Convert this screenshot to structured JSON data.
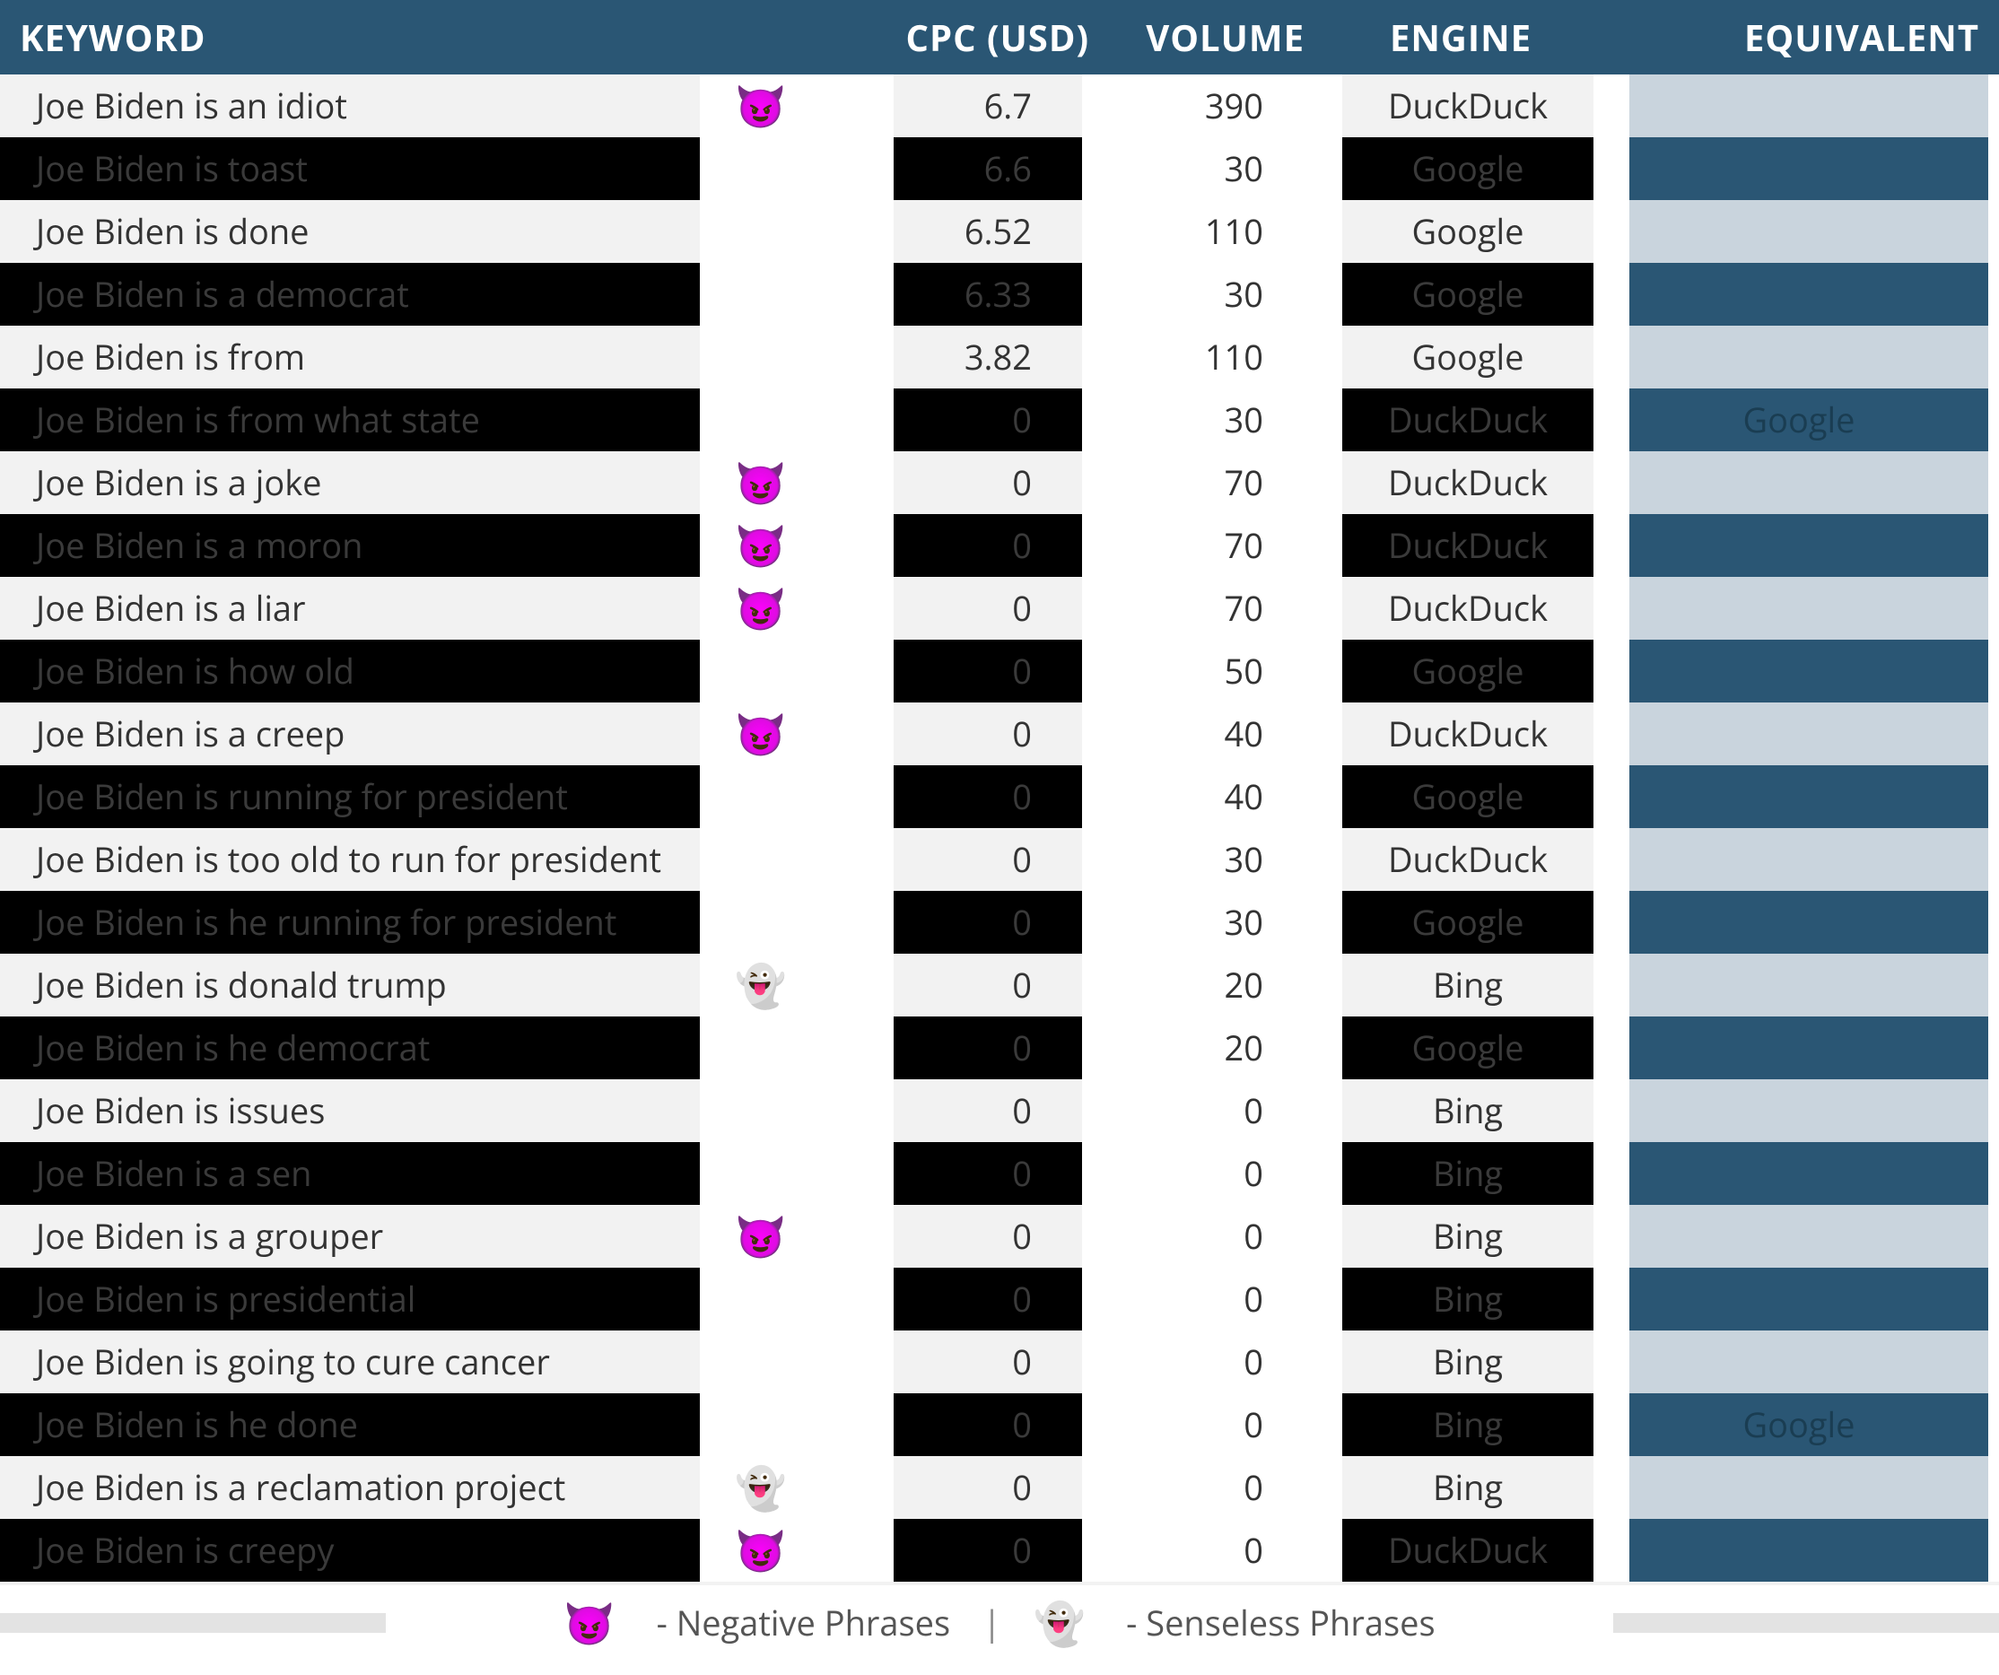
{
  "headers": {
    "keyword": "KEYWORD",
    "cpc": "CPC (USD)",
    "volume": "VOLUME",
    "engine": "ENGINE",
    "equivalent": "EQUIVALENT"
  },
  "legend": {
    "negative": "Negative Phrases",
    "senseless": "Senseless Phrases"
  },
  "rows": [
    {
      "keyword": "Joe Biden is an idiot",
      "tag": "negative",
      "cpc": "6.7",
      "volume": "390",
      "engine": "DuckDuck",
      "equivalent": "",
      "style": "light"
    },
    {
      "keyword": "Joe Biden is toast",
      "tag": "",
      "cpc": "6.6",
      "volume": "30",
      "engine": "Google",
      "equivalent": "",
      "style": "dark"
    },
    {
      "keyword": "Joe Biden is done",
      "tag": "",
      "cpc": "6.52",
      "volume": "110",
      "engine": "Google",
      "equivalent": "",
      "style": "light"
    },
    {
      "keyword": "Joe Biden is a democrat",
      "tag": "",
      "cpc": "6.33",
      "volume": "30",
      "engine": "Google",
      "equivalent": "",
      "style": "dark"
    },
    {
      "keyword": "Joe Biden is from",
      "tag": "",
      "cpc": "3.82",
      "volume": "110",
      "engine": "Google",
      "equivalent": "",
      "style": "light"
    },
    {
      "keyword": "Joe Biden is from what state",
      "tag": "",
      "cpc": "0",
      "volume": "30",
      "engine": "DuckDuck",
      "equivalent": "Google",
      "style": "dark"
    },
    {
      "keyword": "Joe Biden is a joke",
      "tag": "negative",
      "cpc": "0",
      "volume": "70",
      "engine": "DuckDuck",
      "equivalent": "",
      "style": "light"
    },
    {
      "keyword": "Joe Biden is a moron",
      "tag": "negative",
      "cpc": "0",
      "volume": "70",
      "engine": "DuckDuck",
      "equivalent": "",
      "style": "dark"
    },
    {
      "keyword": "Joe Biden is a liar",
      "tag": "negative",
      "cpc": "0",
      "volume": "70",
      "engine": "DuckDuck",
      "equivalent": "",
      "style": "light"
    },
    {
      "keyword": "Joe Biden is how old",
      "tag": "",
      "cpc": "0",
      "volume": "50",
      "engine": "Google",
      "equivalent": "",
      "style": "dark"
    },
    {
      "keyword": "Joe Biden is a creep",
      "tag": "negative",
      "cpc": "0",
      "volume": "40",
      "engine": "DuckDuck",
      "equivalent": "",
      "style": "light"
    },
    {
      "keyword": "Joe Biden is running for president",
      "tag": "",
      "cpc": "0",
      "volume": "40",
      "engine": "Google",
      "equivalent": "",
      "style": "dark"
    },
    {
      "keyword": "Joe Biden is too old to run for president",
      "tag": "",
      "cpc": "0",
      "volume": "30",
      "engine": "DuckDuck",
      "equivalent": "",
      "style": "light"
    },
    {
      "keyword": "Joe Biden is he running for president",
      "tag": "",
      "cpc": "0",
      "volume": "30",
      "engine": "Google",
      "equivalent": "",
      "style": "dark"
    },
    {
      "keyword": "Joe Biden is donald trump",
      "tag": "senseless",
      "cpc": "0",
      "volume": "20",
      "engine": "Bing",
      "equivalent": "",
      "style": "light"
    },
    {
      "keyword": "Joe Biden is he democrat",
      "tag": "",
      "cpc": "0",
      "volume": "20",
      "engine": "Google",
      "equivalent": "",
      "style": "dark"
    },
    {
      "keyword": "Joe Biden is issues",
      "tag": "",
      "cpc": "0",
      "volume": "0",
      "engine": "Bing",
      "equivalent": "",
      "style": "light"
    },
    {
      "keyword": "Joe Biden is a sen",
      "tag": "",
      "cpc": "0",
      "volume": "0",
      "engine": "Bing",
      "equivalent": "",
      "style": "dark"
    },
    {
      "keyword": "Joe Biden is a grouper",
      "tag": "negative",
      "cpc": "0",
      "volume": "0",
      "engine": "Bing",
      "equivalent": "",
      "style": "light"
    },
    {
      "keyword": "Joe Biden is presidential",
      "tag": "",
      "cpc": "0",
      "volume": "0",
      "engine": "Bing",
      "equivalent": "",
      "style": "dark"
    },
    {
      "keyword": "Joe Biden is going to cure cancer",
      "tag": "",
      "cpc": "0",
      "volume": "0",
      "engine": "Bing",
      "equivalent": "",
      "style": "light"
    },
    {
      "keyword": "Joe Biden is he done",
      "tag": "",
      "cpc": "0",
      "volume": "0",
      "engine": "Bing",
      "equivalent": "Google",
      "style": "dark"
    },
    {
      "keyword": "Joe Biden is a reclamation project",
      "tag": "senseless",
      "cpc": "0",
      "volume": "0",
      "engine": "Bing",
      "equivalent": "",
      "style": "light"
    },
    {
      "keyword": "Joe Biden is creepy",
      "tag": "negative",
      "cpc": "0",
      "volume": "0",
      "engine": "DuckDuck",
      "equivalent": "",
      "style": "dark"
    }
  ]
}
